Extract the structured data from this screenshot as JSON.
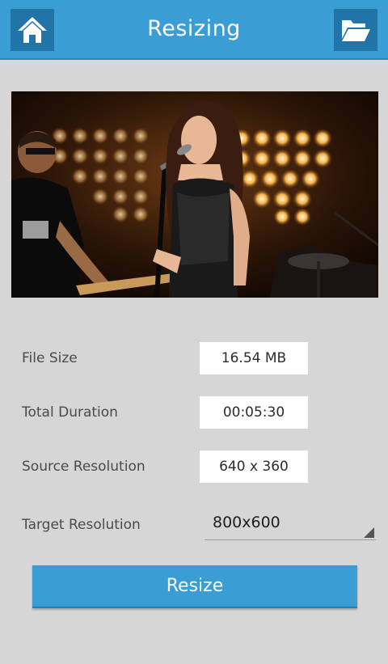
{
  "header": {
    "title": "Resizing",
    "home_icon": "home-icon",
    "folder_icon": "folder-open-icon",
    "accent_color": "#3a9ed4"
  },
  "preview": {
    "description_icon": "video-thumbnail"
  },
  "info": {
    "file_size_label": "File Size",
    "file_size_value": "16.54 MB",
    "duration_label": "Total Duration",
    "duration_value": "00:05:30",
    "source_res_label": "Source Resolution",
    "source_res_value": "640 x  360",
    "target_res_label": "Target Resolution",
    "target_res_value": "800x600"
  },
  "actions": {
    "resize_label": "Resize"
  }
}
